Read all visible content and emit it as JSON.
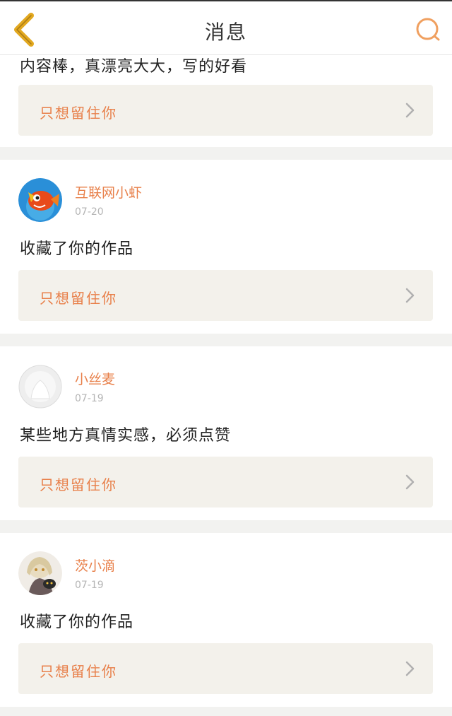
{
  "header": {
    "title": "消息"
  },
  "partial_item": {
    "comment": "内容棒，真漂亮大大，写的好看",
    "work_title": "只想留住你"
  },
  "items": [
    {
      "username": "互联网小虾",
      "date": "07-20",
      "comment": "收藏了你的作品",
      "work_title": "只想留住你",
      "avatar": "fish-avatar"
    },
    {
      "username": "小丝麦",
      "date": "07-19",
      "comment": "某些地方真情实感，必须点赞",
      "work_title": "只想留住你",
      "avatar": "default-avatar"
    },
    {
      "username": "茨小滴",
      "date": "07-19",
      "comment": "收藏了你的作品",
      "work_title": "只想留住你",
      "avatar": "anime-avatar"
    }
  ],
  "colors": {
    "accent": "#e8804a",
    "back_arrow": "#e2a81f",
    "ref_bg": "#f3f1eb"
  }
}
